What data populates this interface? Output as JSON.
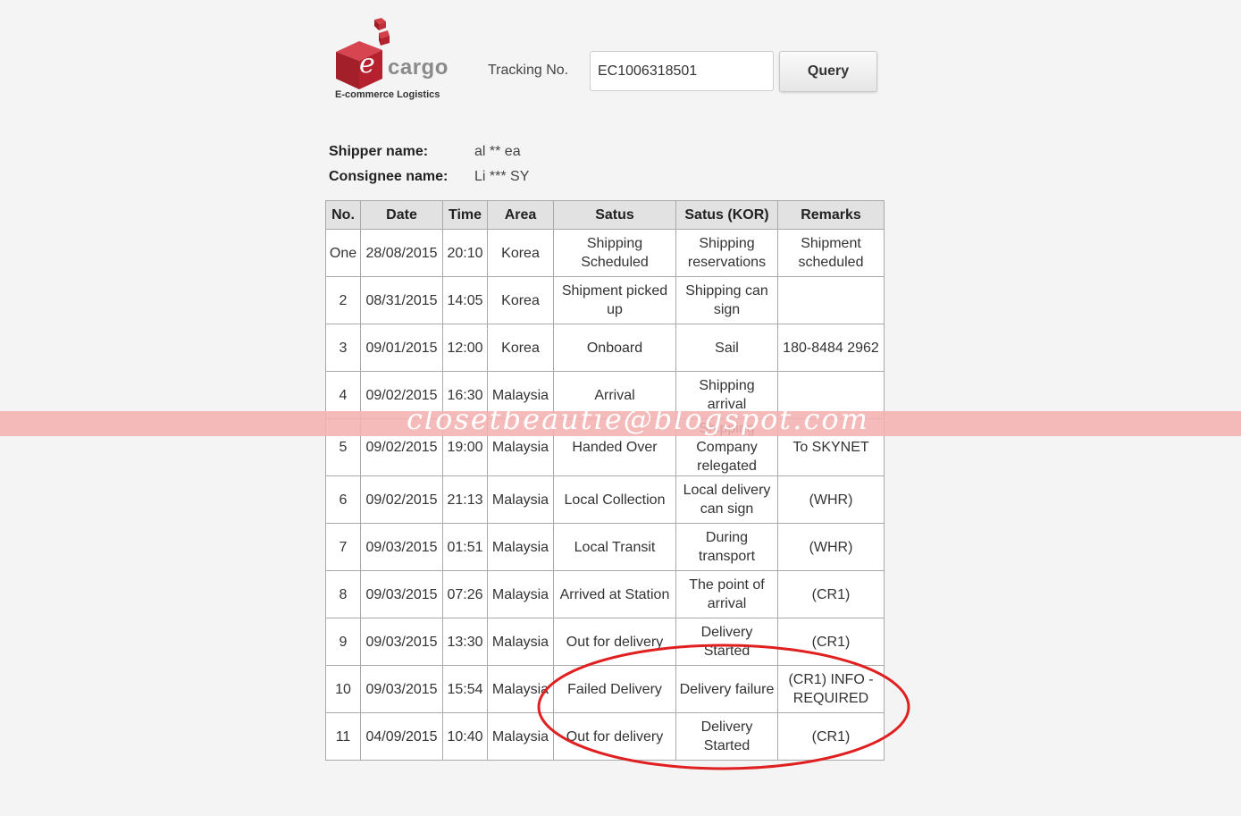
{
  "logo": {
    "icon": "ecargo-cube-logo",
    "brand_color": "#b5212e",
    "word": "cargo",
    "tagline": "E-commerce Logistics"
  },
  "search": {
    "label": "Tracking No.",
    "value": "EC1006318501",
    "button": "Query"
  },
  "shipper": {
    "label": "Shipper name:",
    "value": "al ** ea"
  },
  "consignee": {
    "label": "Consignee name:",
    "value": "Li *** SY"
  },
  "table": {
    "headers": [
      "No.",
      "Date",
      "Time",
      "Area",
      "Satus",
      "Satus (KOR)",
      "Remarks"
    ],
    "rows": [
      [
        "One",
        "28/08/2015",
        "20:10",
        "Korea",
        "Shipping Scheduled",
        "Shipping reservations",
        "Shipment scheduled"
      ],
      [
        "2",
        "08/31/2015",
        "14:05",
        "Korea",
        "Shipment picked up",
        "Shipping can sign",
        ""
      ],
      [
        "3",
        "09/01/2015",
        "12:00",
        "Korea",
        "Onboard",
        "Sail",
        "180-8484 2962"
      ],
      [
        "4",
        "09/02/2015",
        "16:30",
        "Malaysia",
        "Arrival",
        "Shipping arrival",
        ""
      ],
      [
        "5",
        "09/02/2015",
        "19:00",
        "Malaysia",
        "Handed Over",
        "Shipping Company relegated",
        "To SKYNET"
      ],
      [
        "6",
        "09/02/2015",
        "21:13",
        "Malaysia",
        "Local Collection",
        "Local delivery can sign",
        "(WHR)"
      ],
      [
        "7",
        "09/03/2015",
        "01:51",
        "Malaysia",
        "Local Transit",
        "During transport",
        "(WHR)"
      ],
      [
        "8",
        "09/03/2015",
        "07:26",
        "Malaysia",
        "Arrived at Station",
        "The point of arrival",
        "(CR1)"
      ],
      [
        "9",
        "09/03/2015",
        "13:30",
        "Malaysia",
        "Out for delivery",
        "Delivery Started",
        "(CR1)"
      ],
      [
        "10",
        "09/03/2015",
        "15:54",
        "Malaysia",
        "Failed Delivery",
        "Delivery failure",
        "(CR1) INFO - REQUIRED"
      ],
      [
        "11",
        "04/09/2015",
        "10:40",
        "Malaysia",
        "Out for delivery",
        "Delivery Started",
        "(CR1)"
      ]
    ]
  },
  "watermark": {
    "text": "closetbeautie@blogspot.com",
    "band_color": "#f4b2b2"
  },
  "annotation": {
    "color": "#e02020"
  }
}
